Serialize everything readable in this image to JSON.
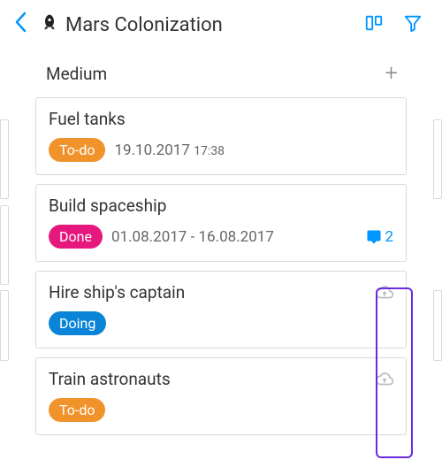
{
  "header": {
    "title": "Mars Colonization"
  },
  "column": {
    "title": "Medium"
  },
  "cards": [
    {
      "title": "Fuel tanks",
      "status": "To-do",
      "status_color": "orange",
      "date": "19.10.2017",
      "time": "17:38"
    },
    {
      "title": "Build spaceship",
      "status": "Done",
      "status_color": "pink",
      "date_range": "01.08.2017 - 16.08.2017",
      "comment_count": "2"
    },
    {
      "title": "Hire ship's captain",
      "status": "Doing",
      "status_color": "blue",
      "has_cloud": true
    },
    {
      "title": "Train astronauts",
      "status": "To-do",
      "status_color": "orange",
      "has_cloud": true
    }
  ]
}
